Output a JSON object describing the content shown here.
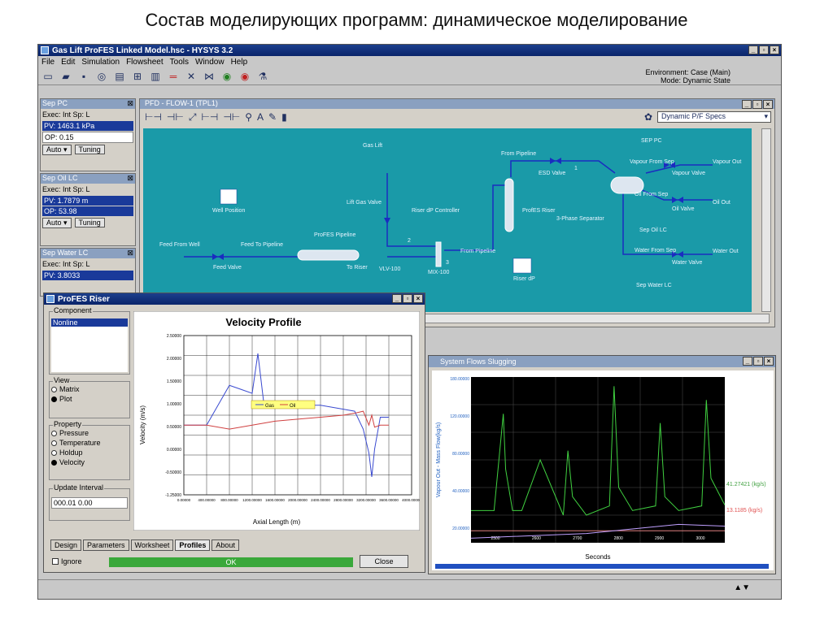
{
  "slide": {
    "title": "Состав моделирующих программ: динамическое моделирование"
  },
  "app": {
    "title": "Gas Lift ProFES Linked Model.hsc - HYSYS 3.2",
    "menu": [
      "File",
      "Edit",
      "Simulation",
      "Flowsheet",
      "Tools",
      "Window",
      "Help"
    ],
    "environment": "Environment: Case (Main)",
    "mode": "Mode: Dynamic State"
  },
  "panels": [
    {
      "title": "Sep PC",
      "exec": "Exec: Int   Sp: L",
      "pv": "PV: 1463.1 kPa",
      "op": "OP: 0.15",
      "mode": "Auto",
      "tuning": "Tuning"
    },
    {
      "title": "Sep Oil LC",
      "exec": "Exec: Int   Sp: L",
      "pv": "PV: 1.7879 m",
      "op": "OP: 53.98",
      "mode": "Auto",
      "tuning": "Tuning"
    },
    {
      "title": "Sep Water LC",
      "exec": "Exec: Int   Sp: L",
      "pv": "PV: 3.8033"
    }
  ],
  "pfd": {
    "title": "PFD - FLOW-1 (TPL1)",
    "dropdown": "Dynamic P/F Specs",
    "labels": {
      "gas_lift": "Gas Lift",
      "lift_gas_valve": "Lift Gas Valve",
      "riser_dp_controller": "Riser dP Controller",
      "from_pipeline": "From Pipeline",
      "esd_valve": "ESD Valve",
      "profes_riser": "ProfES Riser",
      "three_phase_sep": "3-Phase Separator",
      "sep_pc": "SEP PC",
      "vapour_from_sep": "Vapour From Sep",
      "vapour_valve": "Vapour Valve",
      "vapour_out": "Vapour Out",
      "oil_from_sep": "Oil From Sep",
      "oil_valve": "Oil Valve",
      "oil_out": "Oil Out",
      "sep_oil_lc": "Sep Oil LC",
      "water_from_sep": "Water From Sep",
      "water_valve": "Water Valve",
      "water_out": "Water Out",
      "sep_water_lc": "Sep Water LC",
      "well_position": "Well Position",
      "feed_from_well": "Feed From Well",
      "feed_to_pipeline": "Feed To Pipeline",
      "profes_pipeline": "ProFES Pipeline",
      "feed_valve": "Feed Valve",
      "to_riser": "To Riser",
      "vlv100": "VLV-100",
      "mix100": "MIX-100",
      "from_pipeline2": "From Pipeline",
      "riser_dp": "Riser dP",
      "stream_1": "1",
      "stream_2": "2",
      "stream_3": "3"
    }
  },
  "riser": {
    "title": "ProFES Riser",
    "component_caption": "Component",
    "component_item": "Nonline",
    "view_caption": "View",
    "view_options": [
      "Matrix",
      "Plot"
    ],
    "property_caption": "Property",
    "property_options": [
      "Pressure",
      "Temperature",
      "Holdup",
      "Velocity"
    ],
    "update_caption": "Update Interval",
    "update_value": "000.01 0.00",
    "tabs": [
      "Design",
      "Parameters",
      "Worksheet",
      "Profiles",
      "About"
    ],
    "ignore": "Ignore",
    "ok": "OK",
    "close": "Close"
  },
  "velocity_chart": {
    "chart_data": {
      "type": "line",
      "title": "Velocity Profile",
      "xlabel": "Axial Length (m)",
      "ylabel": "Velocity (m/s)",
      "ylim": [
        -1.25,
        2.75
      ],
      "yticks": [
        "2.50000",
        "2.00000",
        "1.50000",
        "1.00000",
        "0.50000",
        "0.00000",
        "-0.50000",
        "-1.25000"
      ],
      "xticks": [
        "0.00000",
        "400.00000",
        "800.00000",
        "1200.00000",
        "1600.00000",
        "2000.00000",
        "2400.00000",
        "2800.00000",
        "3200.00000",
        "3600.00000",
        "4000.00000"
      ],
      "legend": [
        "Gas",
        "Oil"
      ],
      "series": [
        {
          "name": "Gas",
          "color": "#3a4ad0",
          "x": [
            0,
            400,
            800,
            1000,
            1200,
            1300,
            1400,
            1600,
            2000,
            2400,
            2800,
            3000,
            3150,
            3250,
            3300,
            3350,
            3450,
            3600
          ],
          "y": [
            0.5,
            0.5,
            1.5,
            1.4,
            1.3,
            2.3,
            1.1,
            1.05,
            1.0,
            1.0,
            0.9,
            0.85,
            0.4,
            -0.2,
            -0.8,
            -0.1,
            0.7,
            0.7
          ]
        },
        {
          "name": "Oil",
          "color": "#d04040",
          "x": [
            0,
            400,
            800,
            1200,
            1600,
            2000,
            2400,
            2800,
            3000,
            3150,
            3250,
            3300,
            3350,
            3450,
            3600
          ],
          "y": [
            0.5,
            0.5,
            0.4,
            0.5,
            0.6,
            0.65,
            0.7,
            0.75,
            0.8,
            0.85,
            0.5,
            0.75,
            0.45,
            0.5,
            0.5
          ]
        }
      ]
    }
  },
  "slugging": {
    "title": "System Flows Slugging",
    "chart_data": {
      "type": "line",
      "xlabel": "Seconds",
      "ylabel": "Vapour Out - Mass Flow(kg/s)",
      "ylim": [
        0,
        180
      ],
      "yticks": [
        "180.00000",
        "120.00000",
        "80.00000",
        "40.00000",
        "20.00000"
      ],
      "xticks": [
        "2500",
        "2600",
        "2700",
        "2800",
        "2900",
        "3000"
      ],
      "right_labels": [
        "41.27421 (kg/s)",
        "13.1185 (kg/s)"
      ],
      "series": [
        {
          "name": "Vapour Out",
          "color": "#40d040",
          "x": [
            2450,
            2500,
            2520,
            2525,
            2540,
            2560,
            2600,
            2650,
            2660,
            2670,
            2700,
            2750,
            2760,
            2770,
            2800,
            2850,
            2860,
            2870,
            2900,
            2950,
            2960,
            2970,
            3000
          ],
          "y": [
            35,
            35,
            140,
            80,
            35,
            35,
            90,
            30,
            100,
            50,
            30,
            40,
            170,
            60,
            35,
            40,
            130,
            50,
            35,
            40,
            155,
            70,
            41
          ]
        },
        {
          "name": "Flow 2",
          "color": "#e08080",
          "x": [
            2450,
            3000
          ],
          "y": [
            13,
            13
          ]
        },
        {
          "name": "Flow 3",
          "color": "#c0a0ff",
          "x": [
            2450,
            2700,
            2800,
            2900,
            3000
          ],
          "y": [
            5,
            10,
            15,
            20,
            18
          ]
        }
      ]
    }
  }
}
